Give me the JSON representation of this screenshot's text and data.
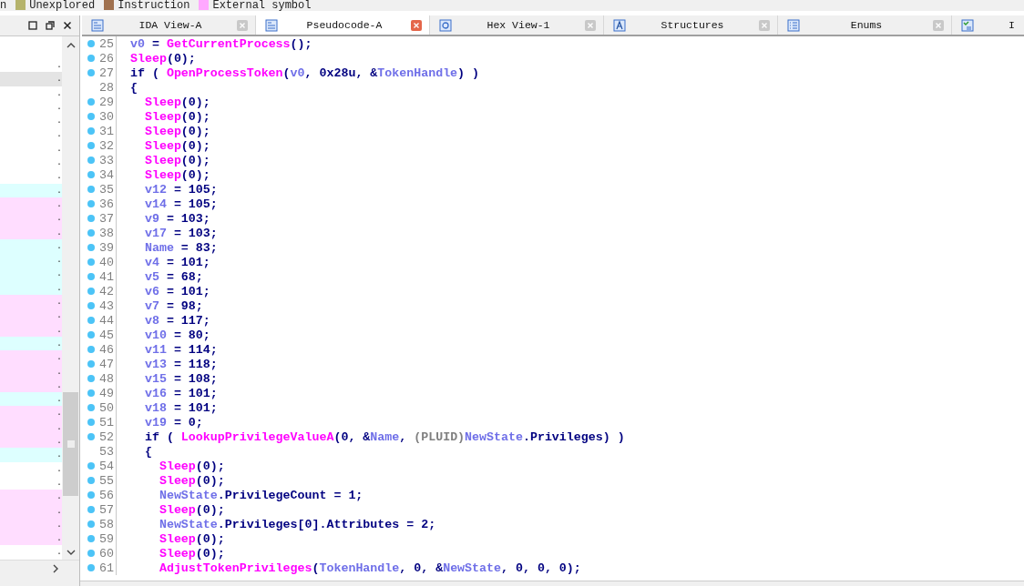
{
  "legend": [
    {
      "label": "n"
    },
    {
      "label": "Unexplored",
      "color": "#b5b36b"
    },
    {
      "label": "Instruction",
      "color": "#a0714f"
    },
    {
      "label": "External symbol",
      "color": "#ffa8ff"
    }
  ],
  "side_panel": {
    "rows": [
      {
        "text": ".",
        "color": "#ffffff",
        "selected": false
      },
      {
        "text": ".",
        "color": "#e4e4e4",
        "selected": false
      },
      {
        "text": ".",
        "color": "#ffffff",
        "selected": false
      },
      {
        "text": ".",
        "color": "#ffffff",
        "selected": false
      },
      {
        "text": ".",
        "color": "#ffffff",
        "selected": false
      },
      {
        "text": ".",
        "color": "#ffffff",
        "selected": false
      },
      {
        "text": ".",
        "color": "#ffffff",
        "selected": false
      },
      {
        "text": ".",
        "color": "#ffffff",
        "selected": false
      },
      {
        "text": ".",
        "color": "#ffffff",
        "selected": false
      },
      {
        "text": ".",
        "color": "#ddffff",
        "selected": false
      },
      {
        "text": ".",
        "color": "#ffddff",
        "selected": false
      },
      {
        "text": ".",
        "color": "#ffddff",
        "selected": false
      },
      {
        "text": ".",
        "color": "#ffddff",
        "selected": false
      },
      {
        "text": ".",
        "color": "#ddffff",
        "selected": false
      },
      {
        "text": ".",
        "color": "#ddffff",
        "selected": false
      },
      {
        "text": ".",
        "color": "#ddffff",
        "selected": false
      },
      {
        "text": ".",
        "color": "#ddffff",
        "selected": false
      },
      {
        "text": ".",
        "color": "#ffddff",
        "selected": false
      },
      {
        "text": ".",
        "color": "#ffddff",
        "selected": false
      },
      {
        "text": ".",
        "color": "#ffddff",
        "selected": false
      },
      {
        "text": ".",
        "color": "#ddffff",
        "selected": false
      },
      {
        "text": ".",
        "color": "#ffddff",
        "selected": false
      },
      {
        "text": ".",
        "color": "#ffddff",
        "selected": false
      },
      {
        "text": ".",
        "color": "#ffddff",
        "selected": false
      },
      {
        "text": ".",
        "color": "#ddffff",
        "selected": false
      },
      {
        "text": ".",
        "color": "#ffddff",
        "selected": false
      },
      {
        "text": ".",
        "color": "#ffddff",
        "selected": false
      },
      {
        "text": ".",
        "color": "#ffddff",
        "selected": false
      },
      {
        "text": ".",
        "color": "#ddffff",
        "selected": false
      },
      {
        "text": ".",
        "color": "#ffffff",
        "selected": false
      },
      {
        "text": ".",
        "color": "#ffffff",
        "selected": false
      },
      {
        "text": ".",
        "color": "#ffddff",
        "selected": false
      },
      {
        "text": ".",
        "color": "#ffddff",
        "selected": false
      },
      {
        "text": ".",
        "color": "#ffddff",
        "selected": false
      },
      {
        "text": ".",
        "color": "#ffddff",
        "selected": false
      },
      {
        "text": ".",
        "color": "#ffffff",
        "selected": false
      }
    ]
  },
  "tabs": [
    {
      "label": "IDA View-A",
      "kind": "listing",
      "selected": false
    },
    {
      "label": "Pseudocode-A",
      "kind": "listing",
      "selected": true
    },
    {
      "label": "Hex View-1",
      "kind": "hex",
      "selected": false
    },
    {
      "label": "Structures",
      "kind": "struct",
      "selected": false
    },
    {
      "label": "Enums",
      "kind": "enum",
      "selected": false
    },
    {
      "label": "I",
      "kind": "imports",
      "selected": false
    }
  ],
  "code": [
    {
      "number": "25",
      "breakpoint": true,
      "tokens": [
        {
          "kind": "var",
          "text": "v0"
        },
        {
          "kind": "code",
          "text": " = "
        },
        {
          "kind": "func",
          "text": "GetCurrentProcess"
        },
        {
          "kind": "code",
          "text": "();"
        }
      ]
    },
    {
      "number": "26",
      "breakpoint": true,
      "tokens": [
        {
          "kind": "func",
          "text": "Sleep"
        },
        {
          "kind": "code",
          "text": "(0);"
        }
      ]
    },
    {
      "number": "27",
      "breakpoint": true,
      "tokens": [
        {
          "kind": "code",
          "text": "if ( "
        },
        {
          "kind": "func",
          "text": "OpenProcessToken"
        },
        {
          "kind": "code",
          "text": "("
        },
        {
          "kind": "var",
          "text": "v0"
        },
        {
          "kind": "code",
          "text": ", 0x28u, &"
        },
        {
          "kind": "var",
          "text": "TokenHandle"
        },
        {
          "kind": "code",
          "text": ") )"
        }
      ]
    },
    {
      "number": "28",
      "breakpoint": false,
      "tokens": [
        {
          "kind": "code",
          "text": "{"
        }
      ]
    },
    {
      "number": "29",
      "breakpoint": true,
      "tokens": [
        {
          "kind": "func",
          "text": "  Sleep"
        },
        {
          "kind": "code",
          "text": "(0);"
        }
      ]
    },
    {
      "number": "30",
      "breakpoint": true,
      "tokens": [
        {
          "kind": "func",
          "text": "  Sleep"
        },
        {
          "kind": "code",
          "text": "(0);"
        }
      ]
    },
    {
      "number": "31",
      "breakpoint": true,
      "tokens": [
        {
          "kind": "func",
          "text": "  Sleep"
        },
        {
          "kind": "code",
          "text": "(0);"
        }
      ]
    },
    {
      "number": "32",
      "breakpoint": true,
      "tokens": [
        {
          "kind": "func",
          "text": "  Sleep"
        },
        {
          "kind": "code",
          "text": "(0);"
        }
      ]
    },
    {
      "number": "33",
      "breakpoint": true,
      "tokens": [
        {
          "kind": "func",
          "text": "  Sleep"
        },
        {
          "kind": "code",
          "text": "(0);"
        }
      ]
    },
    {
      "number": "34",
      "breakpoint": true,
      "tokens": [
        {
          "kind": "func",
          "text": "  Sleep"
        },
        {
          "kind": "code",
          "text": "(0);"
        }
      ]
    },
    {
      "number": "35",
      "breakpoint": true,
      "tokens": [
        {
          "kind": "var",
          "text": "  v12"
        },
        {
          "kind": "code",
          "text": " = 105;"
        }
      ]
    },
    {
      "number": "36",
      "breakpoint": true,
      "tokens": [
        {
          "kind": "var",
          "text": "  v14"
        },
        {
          "kind": "code",
          "text": " = 105;"
        }
      ]
    },
    {
      "number": "37",
      "breakpoint": true,
      "tokens": [
        {
          "kind": "var",
          "text": "  v9"
        },
        {
          "kind": "code",
          "text": " = 103;"
        }
      ]
    },
    {
      "number": "38",
      "breakpoint": true,
      "tokens": [
        {
          "kind": "var",
          "text": "  v17"
        },
        {
          "kind": "code",
          "text": " = 103;"
        }
      ]
    },
    {
      "number": "39",
      "breakpoint": true,
      "tokens": [
        {
          "kind": "var",
          "text": "  Name"
        },
        {
          "kind": "code",
          "text": " = 83;"
        }
      ]
    },
    {
      "number": "40",
      "breakpoint": true,
      "tokens": [
        {
          "kind": "var",
          "text": "  v4"
        },
        {
          "kind": "code",
          "text": " = 101;"
        }
      ]
    },
    {
      "number": "41",
      "breakpoint": true,
      "tokens": [
        {
          "kind": "var",
          "text": "  v5"
        },
        {
          "kind": "code",
          "text": " = 68;"
        }
      ]
    },
    {
      "number": "42",
      "breakpoint": true,
      "tokens": [
        {
          "kind": "var",
          "text": "  v6"
        },
        {
          "kind": "code",
          "text": " = 101;"
        }
      ]
    },
    {
      "number": "43",
      "breakpoint": true,
      "tokens": [
        {
          "kind": "var",
          "text": "  v7"
        },
        {
          "kind": "code",
          "text": " = 98;"
        }
      ]
    },
    {
      "number": "44",
      "breakpoint": true,
      "tokens": [
        {
          "kind": "var",
          "text": "  v8"
        },
        {
          "kind": "code",
          "text": " = 117;"
        }
      ]
    },
    {
      "number": "45",
      "breakpoint": true,
      "tokens": [
        {
          "kind": "var",
          "text": "  v10"
        },
        {
          "kind": "code",
          "text": " = 80;"
        }
      ]
    },
    {
      "number": "46",
      "breakpoint": true,
      "tokens": [
        {
          "kind": "var",
          "text": "  v11"
        },
        {
          "kind": "code",
          "text": " = 114;"
        }
      ]
    },
    {
      "number": "47",
      "breakpoint": true,
      "tokens": [
        {
          "kind": "var",
          "text": "  v13"
        },
        {
          "kind": "code",
          "text": " = 118;"
        }
      ]
    },
    {
      "number": "48",
      "breakpoint": true,
      "tokens": [
        {
          "kind": "var",
          "text": "  v15"
        },
        {
          "kind": "code",
          "text": " = 108;"
        }
      ]
    },
    {
      "number": "49",
      "breakpoint": true,
      "tokens": [
        {
          "kind": "var",
          "text": "  v16"
        },
        {
          "kind": "code",
          "text": " = 101;"
        }
      ]
    },
    {
      "number": "50",
      "breakpoint": true,
      "tokens": [
        {
          "kind": "var",
          "text": "  v18"
        },
        {
          "kind": "code",
          "text": " = 101;"
        }
      ]
    },
    {
      "number": "51",
      "breakpoint": true,
      "tokens": [
        {
          "kind": "var",
          "text": "  v19"
        },
        {
          "kind": "code",
          "text": " = 0;"
        }
      ]
    },
    {
      "number": "52",
      "breakpoint": true,
      "tokens": [
        {
          "kind": "code",
          "text": "  if ( "
        },
        {
          "kind": "func",
          "text": "LookupPrivilegeValueA"
        },
        {
          "kind": "code",
          "text": "(0, &"
        },
        {
          "kind": "var",
          "text": "Name"
        },
        {
          "kind": "code",
          "text": ", "
        },
        {
          "kind": "cast",
          "text": "(PLUID)"
        },
        {
          "kind": "var",
          "text": "NewState"
        },
        {
          "kind": "code",
          "text": ".Privileges) )"
        }
      ]
    },
    {
      "number": "53",
      "breakpoint": false,
      "tokens": [
        {
          "kind": "code",
          "text": "  {"
        }
      ]
    },
    {
      "number": "54",
      "breakpoint": true,
      "tokens": [
        {
          "kind": "func",
          "text": "    Sleep"
        },
        {
          "kind": "code",
          "text": "(0);"
        }
      ]
    },
    {
      "number": "55",
      "breakpoint": true,
      "tokens": [
        {
          "kind": "func",
          "text": "    Sleep"
        },
        {
          "kind": "code",
          "text": "(0);"
        }
      ]
    },
    {
      "number": "56",
      "breakpoint": true,
      "tokens": [
        {
          "kind": "var",
          "text": "    NewState"
        },
        {
          "kind": "code",
          "text": ".PrivilegeCount = 1;"
        }
      ]
    },
    {
      "number": "57",
      "breakpoint": true,
      "tokens": [
        {
          "kind": "func",
          "text": "    Sleep"
        },
        {
          "kind": "code",
          "text": "(0);"
        }
      ]
    },
    {
      "number": "58",
      "breakpoint": true,
      "tokens": [
        {
          "kind": "var",
          "text": "    NewState"
        },
        {
          "kind": "code",
          "text": ".Privileges[0].Attributes = 2;"
        }
      ]
    },
    {
      "number": "59",
      "breakpoint": true,
      "tokens": [
        {
          "kind": "func",
          "text": "    Sleep"
        },
        {
          "kind": "code",
          "text": "(0);"
        }
      ]
    },
    {
      "number": "60",
      "breakpoint": true,
      "tokens": [
        {
          "kind": "func",
          "text": "    Sleep"
        },
        {
          "kind": "code",
          "text": "(0);"
        }
      ]
    },
    {
      "number": "61",
      "breakpoint": true,
      "tokens": [
        {
          "kind": "func",
          "text": "    AdjustTokenPrivileges"
        },
        {
          "kind": "code",
          "text": "("
        },
        {
          "kind": "var",
          "text": "TokenHandle"
        },
        {
          "kind": "code",
          "text": ", 0, &"
        },
        {
          "kind": "var",
          "text": "NewState"
        },
        {
          "kind": "code",
          "text": ", 0, 0, 0);"
        }
      ]
    }
  ]
}
